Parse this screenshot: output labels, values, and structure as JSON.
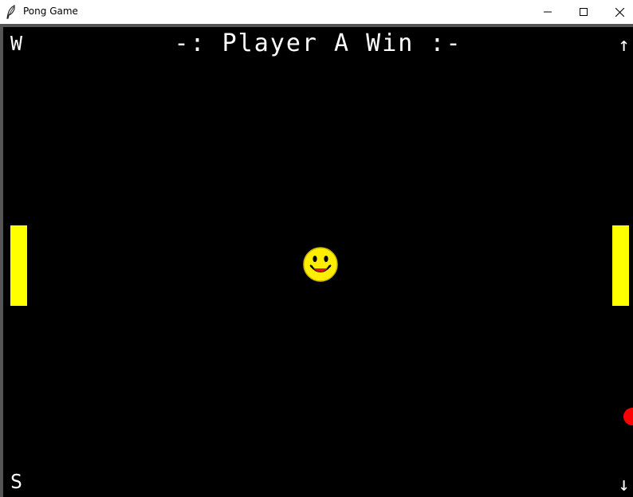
{
  "window": {
    "title": "Pong Game"
  },
  "game": {
    "status_text": "-: Player A Win :-",
    "controls": {
      "player_a_up": "W",
      "player_a_down": "S",
      "player_b_up": "↑",
      "player_b_down": "↓"
    }
  },
  "icons": {
    "app": "feather-icon",
    "minimize": "minimize-icon",
    "maximize": "maximize-icon",
    "close": "close-icon",
    "center": "smiley-face-icon"
  },
  "colors": {
    "background": "#000000",
    "text": "#ffffff",
    "paddle": "#ffff00",
    "ball": "#ff0000",
    "smiley": "#ffff00"
  }
}
